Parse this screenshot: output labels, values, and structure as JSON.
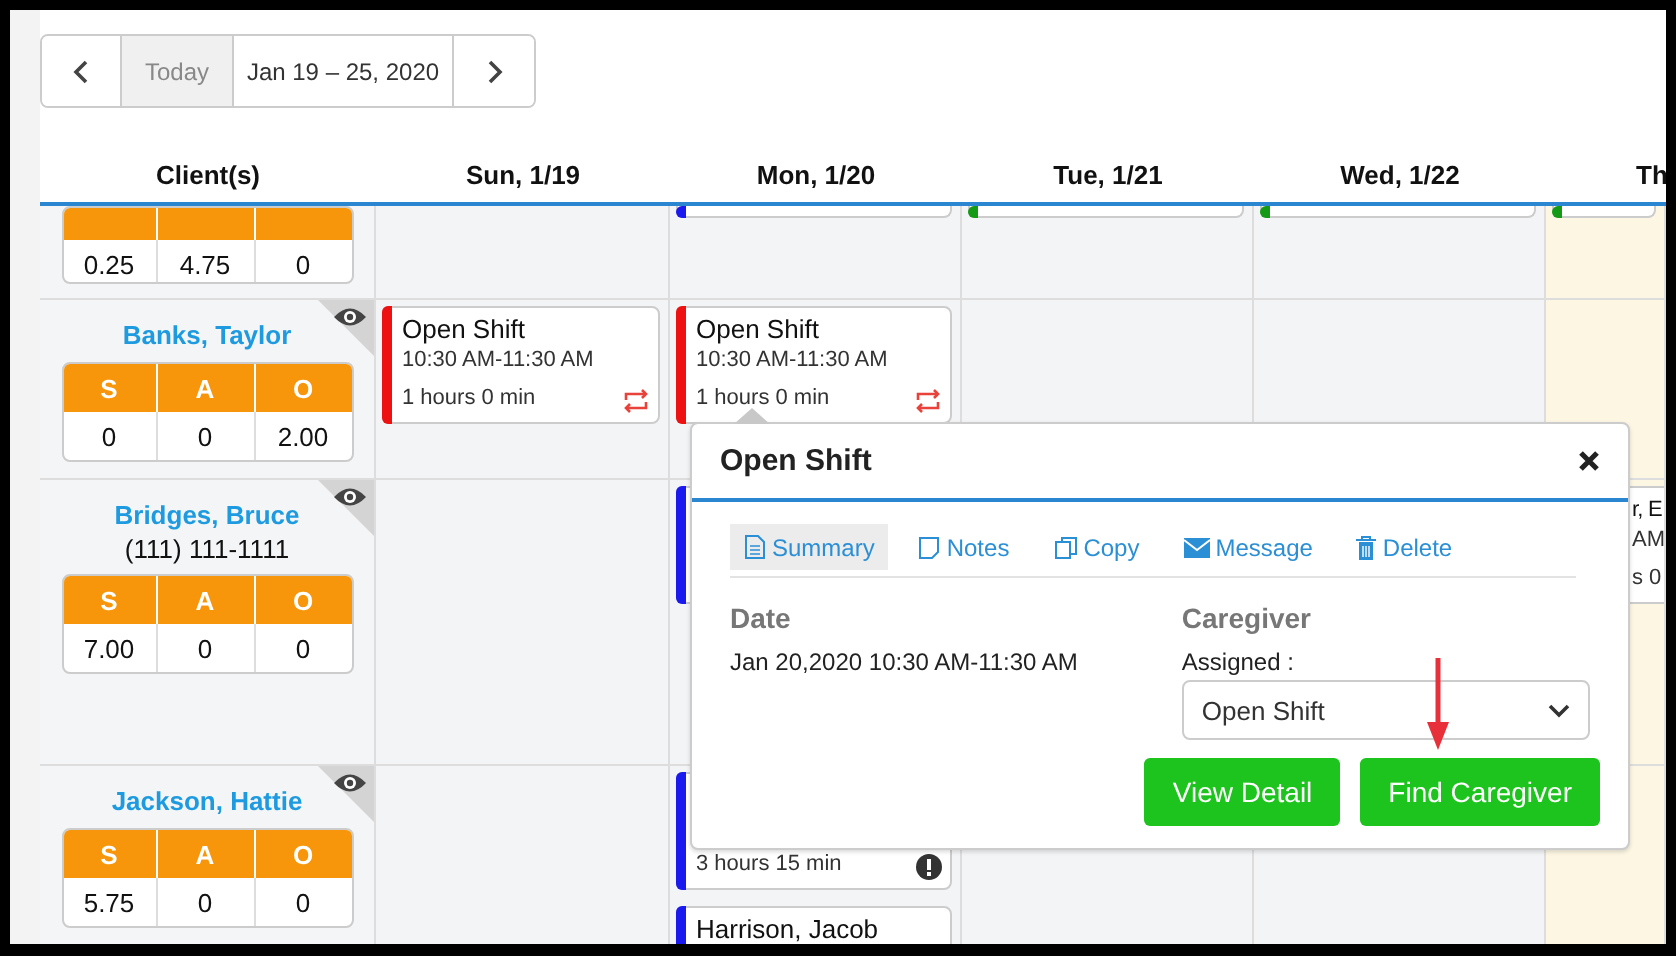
{
  "toolbar": {
    "today": "Today",
    "range": "Jan 19 – 25, 2020"
  },
  "columns": [
    {
      "label": "Client(s)",
      "highlighted": false
    },
    {
      "label": "Sun, 1/19",
      "highlighted": false
    },
    {
      "label": "Mon, 1/20",
      "highlighted": false
    },
    {
      "label": "Tue, 1/21",
      "highlighted": false
    },
    {
      "label": "Wed, 1/22",
      "highlighted": false
    },
    {
      "label": "Th",
      "highlighted": true
    }
  ],
  "rows": [
    {
      "totals": [
        {
          "value": "0.25"
        },
        {
          "value": "4.75"
        },
        {
          "value": "0"
        }
      ],
      "days": {
        "mon": [
          {
            "kind": "stub",
            "color": "#1a1aee"
          }
        ],
        "tue": [
          {
            "kind": "stub",
            "color": "#149a14"
          }
        ],
        "wed": [
          {
            "kind": "stub",
            "color": "#149a14"
          }
        ],
        "thu": [
          {
            "kind": "stub",
            "color": "#149a14"
          }
        ]
      }
    },
    {
      "name": "Banks, Taylor",
      "totals": [
        {
          "label": "S",
          "value": "0"
        },
        {
          "label": "A",
          "value": "0"
        },
        {
          "label": "O",
          "value": "2.00"
        }
      ],
      "days": {
        "sun": [
          {
            "kind": "shift",
            "color": "#ee1111",
            "title": "Open Shift",
            "time": "10:30 AM-11:30 AM",
            "duration": "1 hours 0 min",
            "repeat": true
          }
        ],
        "mon": [
          {
            "kind": "shift",
            "color": "#ee1111",
            "title": "Open Shift",
            "time": "10:30 AM-11:30 AM",
            "duration": "1 hours 0 min",
            "repeat": true
          }
        ]
      }
    },
    {
      "name": "Bridges, Bruce",
      "phone": "(111) 111-1111",
      "totals": [
        {
          "label": "S",
          "value": "7.00"
        },
        {
          "label": "A",
          "value": "0"
        },
        {
          "label": "O",
          "value": "0"
        }
      ],
      "days": {
        "mon": [
          {
            "kind": "shift",
            "color": "#1a1aee"
          }
        ],
        "thu": [
          {
            "kind": "shift",
            "title": "r, E",
            "time": "AM",
            "duration": "s 0"
          }
        ]
      }
    },
    {
      "name": "Jackson, Hattie",
      "totals": [
        {
          "label": "S",
          "value": "5.75"
        },
        {
          "label": "A",
          "value": "0"
        },
        {
          "label": "O",
          "value": "0"
        }
      ],
      "days": {
        "mon": [
          {
            "kind": "shift",
            "color": "#1a1aee",
            "duration": "3 hours 15 min",
            "alert": true
          },
          {
            "kind": "shift",
            "color": "#1a1aee",
            "title": "Harrison, Jacob"
          }
        ]
      }
    }
  ],
  "popup": {
    "title": "Open Shift",
    "tabs": [
      {
        "label": "Summary",
        "selected": true
      },
      {
        "label": "Notes",
        "selected": false
      },
      {
        "label": "Copy",
        "selected": false
      },
      {
        "label": "Message",
        "selected": false
      },
      {
        "label": "Delete",
        "selected": false
      }
    ],
    "date_label": "Date",
    "date_value": "Jan 20,2020 10:30 AM-11:30 AM",
    "caregiver_label": "Caregiver",
    "assigned_label": "Assigned :",
    "assigned_value": "Open Shift",
    "buttons": [
      "View Detail",
      "Find Caregiver"
    ]
  }
}
